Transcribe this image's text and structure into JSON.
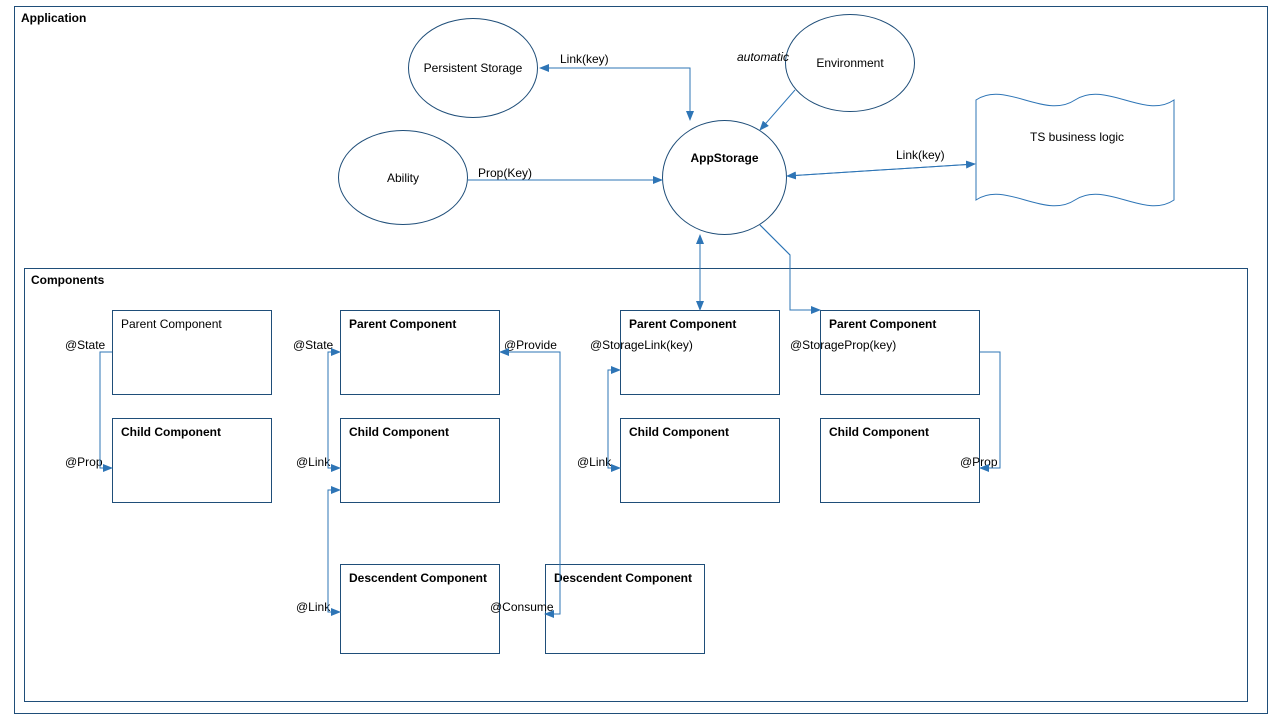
{
  "app": {
    "title": "Application",
    "nodes": {
      "persistent": "Persistent Storage",
      "environment": "Environment",
      "ability": "Ability",
      "appstorage": "AppStorage",
      "ts": "TS business logic"
    },
    "edges": {
      "link_key_1": "Link(key)",
      "automatic": "automatic",
      "prop_key": "Prop(Key)",
      "link_key_2": "Link(key)"
    }
  },
  "comp": {
    "title": "Components",
    "col1": {
      "parent": "Parent Component",
      "child": "Child Component",
      "state": "@State",
      "prop": "@Prop"
    },
    "col2": {
      "parent": "Parent Component",
      "child": "Child Component",
      "desc": "Descendent Component",
      "state": "@State",
      "link1": "@Link",
      "link2": "@Link",
      "provide": "@Provide",
      "consume": "@Consume"
    },
    "col3": {
      "parent": "Parent Component",
      "child": "Child Component",
      "desc": "Descendent Component",
      "storagelink": "@StorageLink(key)",
      "link": "@Link"
    },
    "col4": {
      "parent": "Parent Component",
      "child": "Child Component",
      "storageprop": "@StorageProp(key)",
      "prop": "@Prop"
    }
  }
}
